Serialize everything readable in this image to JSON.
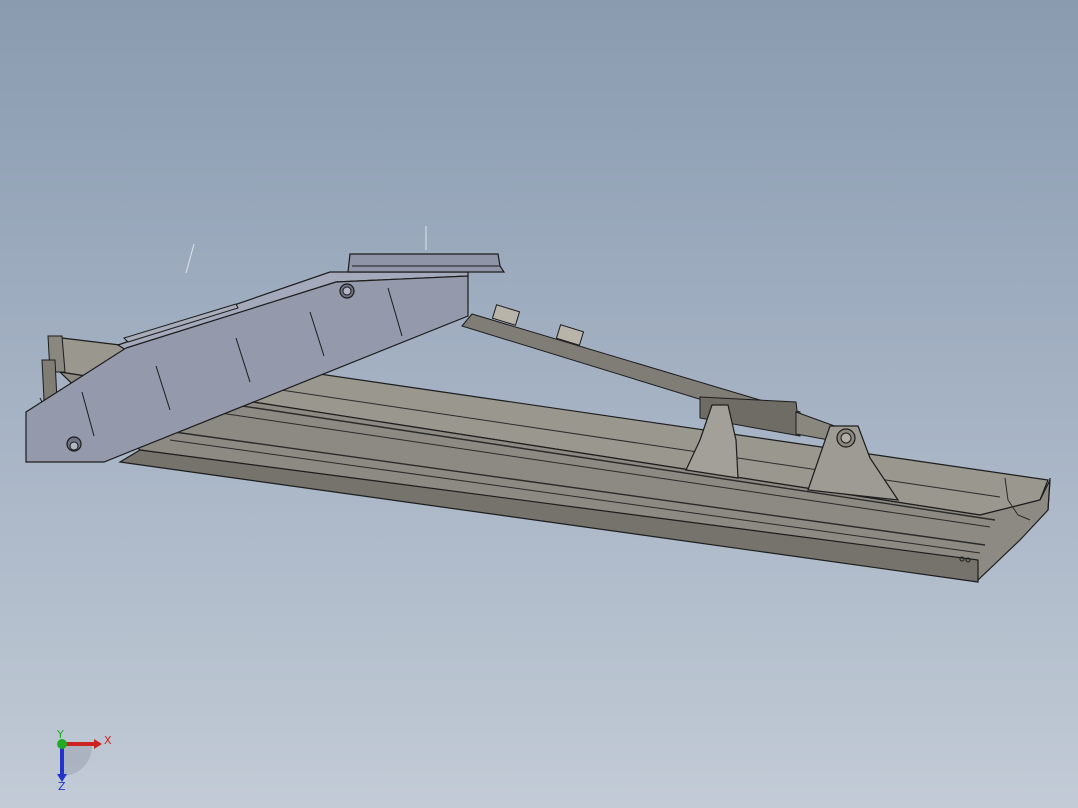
{
  "viewport": {
    "background_top": "#8a9bb0",
    "background_bottom": "#c2cbd6"
  },
  "model": {
    "colors": {
      "trough": "#8c8a82",
      "trough_dark": "#6e6c65",
      "boom": "#9499ac",
      "boom_dark": "#7d8296",
      "cylinder": "#807d76",
      "edge": "#1c1c1c"
    }
  },
  "triad": {
    "x_label": "X",
    "y_label": "Y",
    "z_label": "Z",
    "x_color": "#cc2222",
    "y_color": "#22aa22",
    "z_color": "#2233cc"
  }
}
